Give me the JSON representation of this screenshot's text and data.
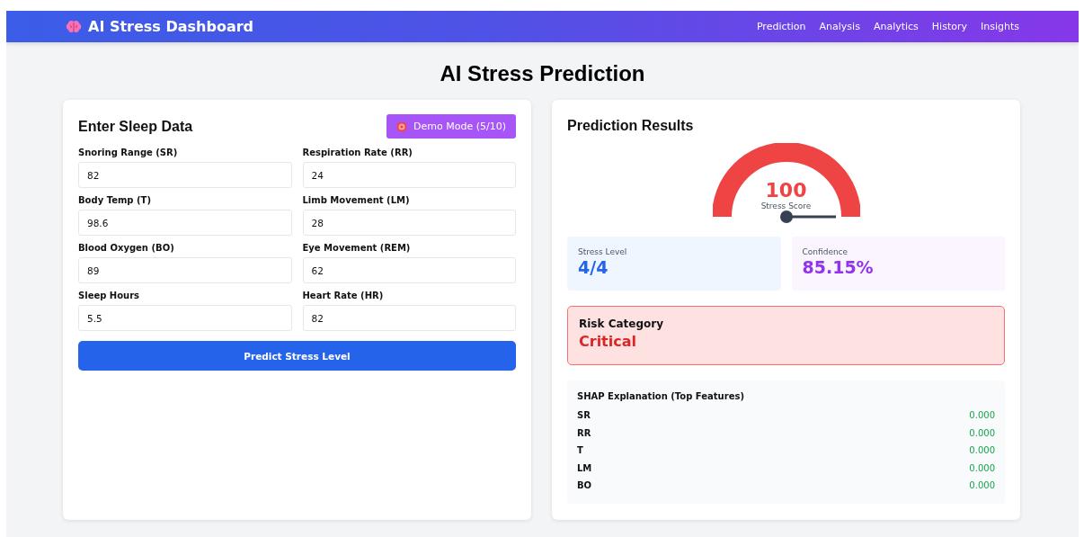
{
  "navbar": {
    "brand": "AI Stress Dashboard",
    "links": [
      {
        "label": "Prediction"
      },
      {
        "label": "Analysis"
      },
      {
        "label": "Analytics"
      },
      {
        "label": "History"
      },
      {
        "label": "Insights"
      }
    ]
  },
  "page_title": "AI Stress Prediction",
  "input_card": {
    "title": "Enter Sleep Data",
    "demo_button": "Demo Mode (5/10)",
    "fields": [
      {
        "label": "Snoring Range (SR)",
        "value": "82"
      },
      {
        "label": "Respiration Rate (RR)",
        "value": "24"
      },
      {
        "label": "Body Temp (T)",
        "value": "98.6"
      },
      {
        "label": "Limb Movement (LM)",
        "value": "28"
      },
      {
        "label": "Blood Oxygen (BO)",
        "value": "89"
      },
      {
        "label": "Eye Movement (REM)",
        "value": "62"
      },
      {
        "label": "Sleep Hours",
        "value": "5.5"
      },
      {
        "label": "Heart Rate (HR)",
        "value": "82"
      }
    ],
    "submit_button": "Predict Stress Level"
  },
  "results_card": {
    "title": "Prediction Results",
    "gauge": {
      "level": 1,
      "value": "100",
      "label": "Stress Score"
    },
    "stats": [
      {
        "label": "Stress Level",
        "value": "4/4",
        "kind": "level"
      },
      {
        "label": "Confidence",
        "value": "85.15%",
        "kind": "confidence"
      }
    ],
    "risk": {
      "label": "Risk Category",
      "value": "Critical"
    },
    "shap": {
      "title": "SHAP Explanation (Top Features)",
      "features": [
        {
          "name": "SR",
          "value": "0.000"
        },
        {
          "name": "RR",
          "value": "0.000"
        },
        {
          "name": "T",
          "value": "0.000"
        },
        {
          "name": "LM",
          "value": "0.000"
        },
        {
          "name": "BO",
          "value": "0.000"
        }
      ]
    }
  }
}
